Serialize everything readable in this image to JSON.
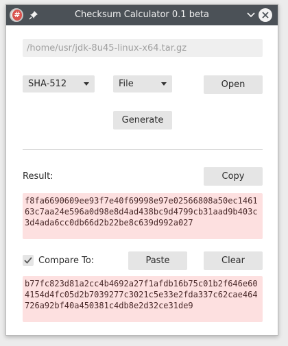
{
  "window": {
    "title": "Checksum Calculator 0.1 beta"
  },
  "icons": {
    "app": "app-hash-icon",
    "pin": "pin-icon",
    "minimize": "chevron-down-icon",
    "close": "close-icon",
    "checkmark": "checkmark-icon"
  },
  "file": {
    "path_placeholder": "/home/usr/jdk-8u45-linux-x64.tar.gz"
  },
  "controls": {
    "algorithm_selected": "SHA-512",
    "source_selected": "File",
    "open_label": "Open",
    "generate_label": "Generate"
  },
  "result": {
    "label": "Result:",
    "copy_label": "Copy",
    "hash": "f8fa6690609ee93f7e40f69998e97e02566808a50ec146163c7aa24e596a0d98e8d4ad438bc9d4799cb31aad9b403c3d4ada6cc0db66d2b22be8c639d992a027"
  },
  "compare": {
    "checked": true,
    "label": "Compare To:",
    "paste_label": "Paste",
    "clear_label": "Clear",
    "hash": "b77fc823d81a2cc4b4692a27f1afdb16b75c01b2f646e604154d4fc05d2b7039277c3021c5e33e2fda337c62cae464726a92bf40a450381c4db8e2d32ce31de9"
  },
  "colors": {
    "titlebar": "#4b5157",
    "hash_background": "#fde0e0",
    "button": "#e5e5e5"
  }
}
